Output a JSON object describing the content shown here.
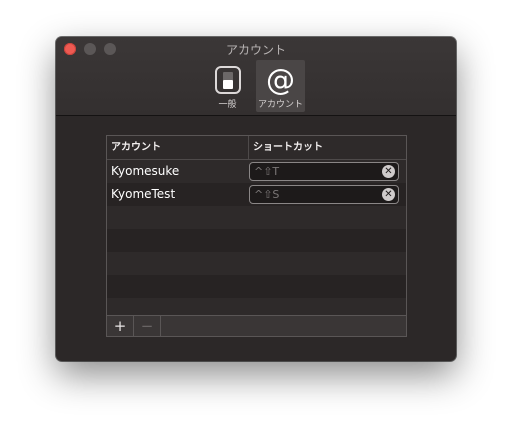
{
  "window": {
    "title": "アカウント"
  },
  "toolbar": {
    "tabs": [
      {
        "label": "一般",
        "icon": "toggle-switch-icon"
      },
      {
        "label": "アカウント",
        "icon": "at-sign-icon"
      }
    ],
    "selected_tab": "アカウント",
    "at_glyph": "@"
  },
  "table": {
    "columns": [
      "アカウント",
      "ショートカット"
    ],
    "rows": [
      {
        "account": "Kyomesuke",
        "shortcut": "^⇧T"
      },
      {
        "account": "KyomeTest",
        "shortcut": "^⇧S"
      }
    ],
    "clear_glyph": "✕",
    "add_label": "+",
    "remove_label": "−"
  },
  "colors": {
    "close_button": "#ee5a52",
    "window_background": "#2c2828",
    "selected_tab_background": "#4a4646"
  }
}
